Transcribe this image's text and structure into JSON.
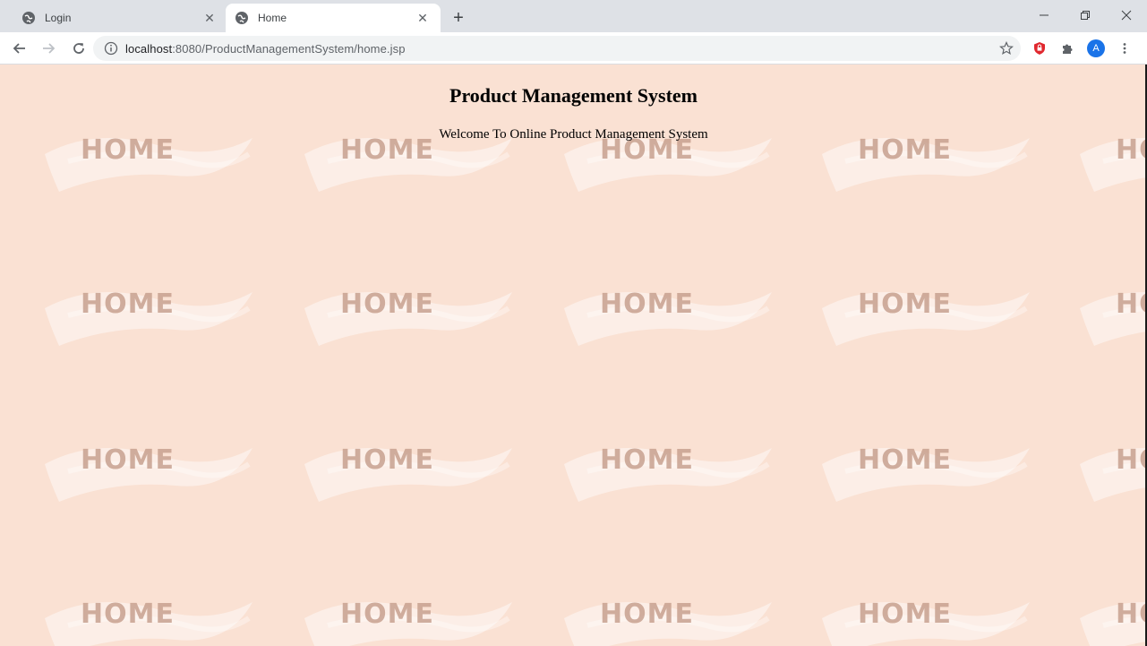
{
  "browser": {
    "tabs": [
      {
        "title": "Login",
        "active": false
      },
      {
        "title": "Home",
        "active": true
      }
    ],
    "new_tab_label": "+",
    "address": {
      "host": "localhost",
      "path": ":8080/ProductManagementSystem/home.jsp"
    },
    "profile_initial": "A",
    "window_controls": [
      "minimize",
      "restore",
      "close"
    ]
  },
  "page": {
    "heading": "Product Management System",
    "welcome": "Welcome To Online Product Management System",
    "background_color": "#fae1d3",
    "watermark_text": "HOME"
  }
}
